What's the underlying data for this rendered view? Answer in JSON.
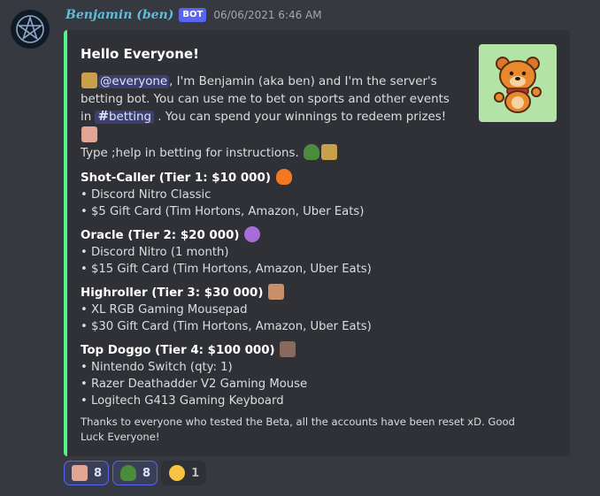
{
  "author": {
    "name": "Benjamin (ben)",
    "tag": "BOT",
    "timestamp": "06/06/2021 6:46 AM"
  },
  "embed": {
    "accent_color": "#57f287",
    "title": "Hello Everyone!",
    "desc": {
      "mention": "@everyone",
      "part1": ", I'm Benjamin (aka ben) and I'm the server's betting bot. You can use me to bet on sports and other events in ",
      "channel": "betting",
      "part2": ". You can spend your winnings to redeem prizes!",
      "part3": "Type ;help in betting for instructions."
    },
    "tiers": [
      {
        "name": "Shot-Caller (Tier 1: $10 000)",
        "emoji": "fire-emoji",
        "items": [
          "• Discord Nitro Classic",
          "• $5 Gift Card (Tim Hortons, Amazon, Uber Eats)"
        ]
      },
      {
        "name": "Oracle (Tier 2: $20 000)",
        "emoji": "crystal-ball-emoji",
        "items": [
          "• Discord Nitro (1 month)",
          "• $15 Gift Card (Tim Hortons, Amazon, Uber Eats)"
        ]
      },
      {
        "name": "Highroller (Tier 3: $30 000)",
        "emoji": "face-emoji",
        "items": [
          "• XL RGB Gaming Mousepad",
          "• $30 Gift Card (Tim Hortons, Amazon, Uber Eats)"
        ]
      },
      {
        "name": "Top Doggo (Tier 4: $100 000)",
        "emoji": "dog-emoji",
        "items": [
          "• Nintendo Switch (qty: 1)",
          "• Razer Deathadder V2 Gaming Mouse",
          "• Logitech G413 Gaming Keyboard"
        ]
      }
    ],
    "footer_note": "Thanks to everyone who tested the Beta, all the accounts have been reset xD. Good Luck Everyone!"
  },
  "reactions": [
    {
      "emoji": "face-emoji",
      "count": "8",
      "active": true
    },
    {
      "emoji": "frog-emoji",
      "count": "8",
      "active": true
    },
    {
      "emoji": "disappointed-emoji",
      "count": "1",
      "active": false
    }
  ]
}
